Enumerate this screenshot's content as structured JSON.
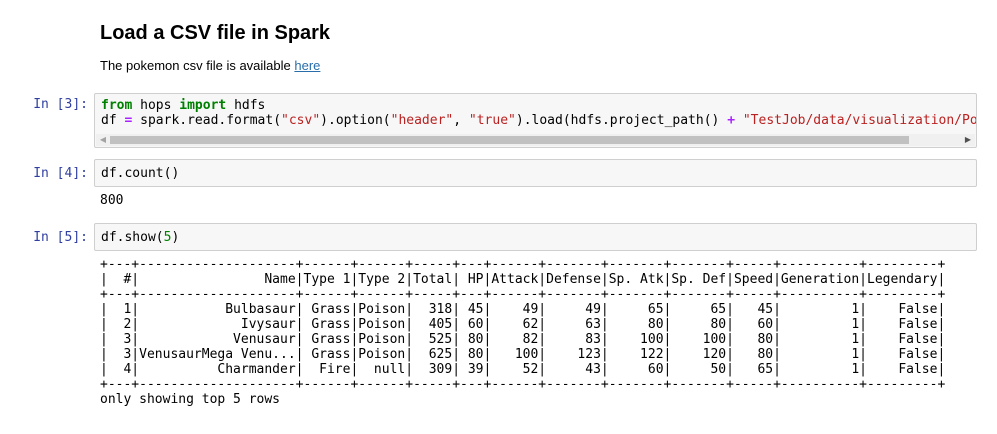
{
  "markdown": {
    "heading": "Load a CSV file in Spark",
    "text_before_link": "The pokemon csv file is available ",
    "link_text": "here"
  },
  "cells": [
    {
      "prompt": "In [3]:",
      "code_lines": [
        [
          {
            "t": "from",
            "c": "kw"
          },
          {
            "t": " hops "
          },
          {
            "t": "import",
            "c": "kw"
          },
          {
            "t": " hdfs"
          }
        ],
        [
          {
            "t": "df "
          },
          {
            "t": "=",
            "c": "op"
          },
          {
            "t": " spark.read.format("
          },
          {
            "t": "\"csv\"",
            "c": "str"
          },
          {
            "t": ").option("
          },
          {
            "t": "\"header\"",
            "c": "str"
          },
          {
            "t": ", "
          },
          {
            "t": "\"true\"",
            "c": "str"
          },
          {
            "t": ").load(hdfs.project_path() "
          },
          {
            "t": "+",
            "c": "op"
          },
          {
            "t": " "
          },
          {
            "t": "\"TestJob/data/visualization/Pokemon.csv\"",
            "c": "str"
          },
          {
            "t": ")"
          }
        ]
      ],
      "output": ""
    },
    {
      "prompt": "In [4]:",
      "code_lines": [
        [
          {
            "t": "df.count()"
          }
        ]
      ],
      "output": "800"
    },
    {
      "prompt": "In [5]:",
      "code_lines": [
        [
          {
            "t": "df.show("
          },
          {
            "t": "5",
            "c": "num"
          },
          {
            "t": ")"
          }
        ]
      ],
      "output": "+---+--------------------+------+------+-----+---+------+-------+-------+-------+-----+----------+---------+\n|  #|                Name|Type 1|Type 2|Total| HP|Attack|Defense|Sp. Atk|Sp. Def|Speed|Generation|Legendary|\n+---+--------------------+------+------+-----+---+------+-------+-------+-------+-----+----------+---------+\n|  1|           Bulbasaur| Grass|Poison|  318| 45|    49|     49|     65|     65|   45|         1|    False|\n|  2|             Ivysaur| Grass|Poison|  405| 60|    62|     63|     80|     80|   60|         1|    False|\n|  3|            Venusaur| Grass|Poison|  525| 80|    82|     83|    100|    100|   80|         1|    False|\n|  3|VenusaurMega Venu...| Grass|Poison|  625| 80|   100|    123|    122|    120|   80|         1|    False|\n|  4|          Charmander|  Fire|  null|  309| 39|    52|     43|     60|     50|   65|         1|    False|\n+---+--------------------+------+------+-----+---+------+-------+-------+-------+-----+----------+---------+\nonly showing top 5 rows"
    }
  ]
}
